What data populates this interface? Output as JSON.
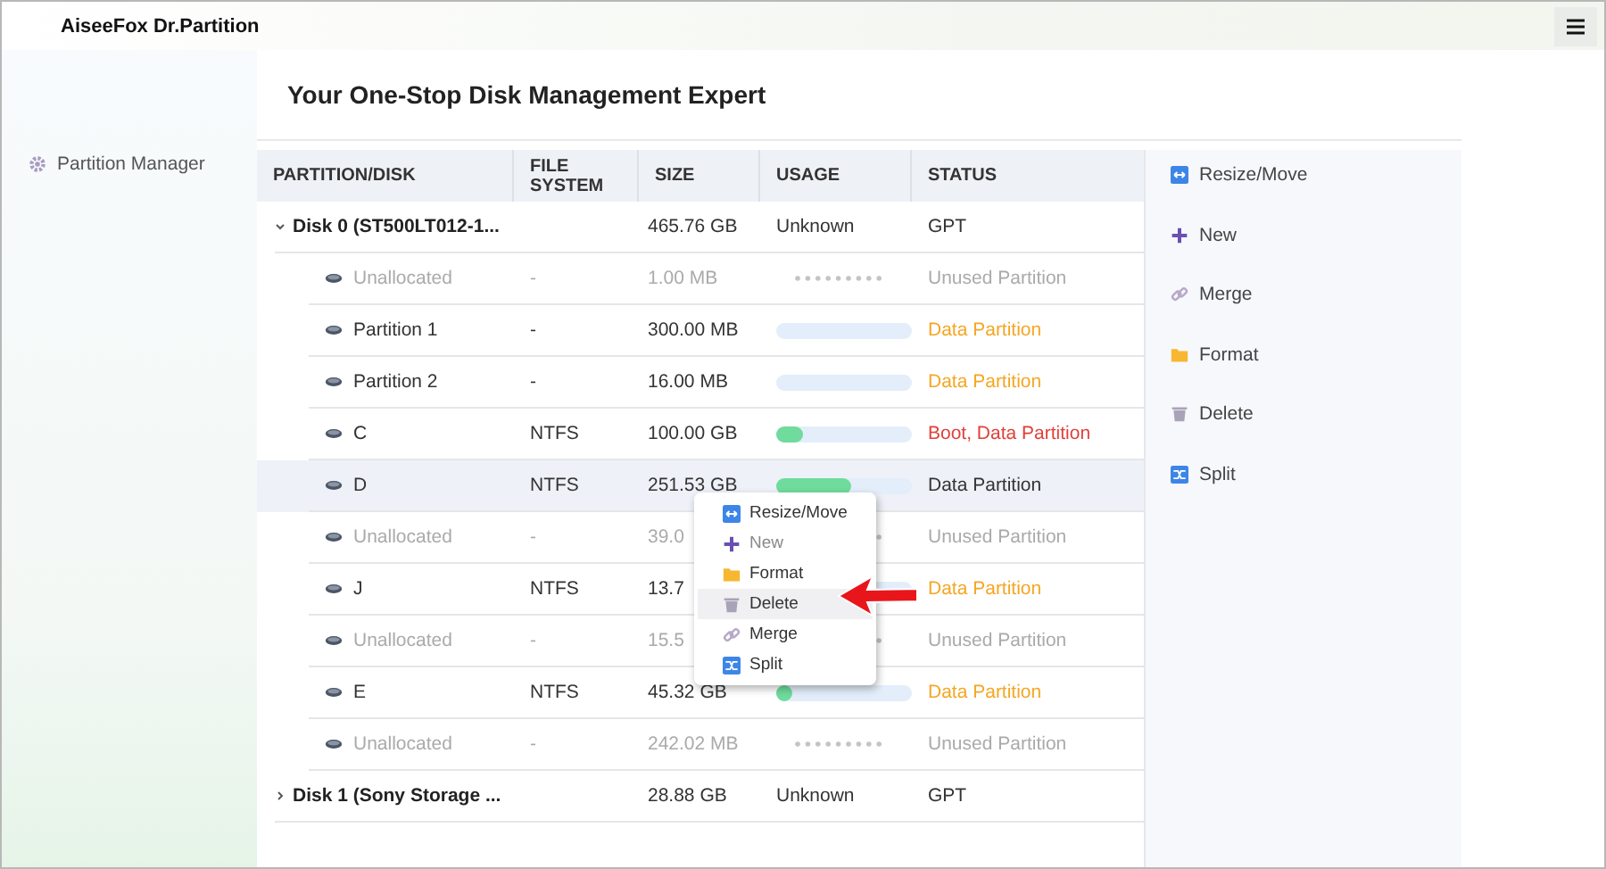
{
  "window": {
    "title": "AiseeFox Dr.Partition"
  },
  "sidebar": {
    "items": [
      {
        "label": "Partition Manager",
        "selected": false
      }
    ]
  },
  "heading": "Your One-Stop Disk Management Expert",
  "table": {
    "columns": [
      "PARTITION/DISK",
      "FILE SYSTEM",
      "SIZE",
      "USAGE",
      "STATUS"
    ],
    "rows": [
      {
        "kind": "disk",
        "name": "Disk 0 (ST500LT012-1...",
        "expanded": true,
        "size": "465.76 GB",
        "usage": {
          "kind": "text",
          "text": "Unknown"
        },
        "status": {
          "text": "GPT",
          "color": "#333333"
        },
        "selected": false
      },
      {
        "kind": "unallocated",
        "name": "Unallocated",
        "file_system": "-",
        "size": "1.00 MB",
        "usage": {
          "kind": "dots"
        },
        "status": {
          "text": "Unused Partition",
          "color": "#aaaaaa"
        },
        "selected": false
      },
      {
        "kind": "partition",
        "name": "Partition 1",
        "file_system": "-",
        "size": "300.00 MB",
        "usage": {
          "kind": "bar"
        },
        "status": {
          "text": "Data Partition",
          "color": "#f5a623"
        },
        "selected": false
      },
      {
        "kind": "partition",
        "name": "Partition 2",
        "file_system": "-",
        "size": "16.00 MB",
        "usage": {
          "kind": "bar"
        },
        "status": {
          "text": "Data Partition",
          "color": "#f5a623"
        },
        "selected": false
      },
      {
        "kind": "partition",
        "name": "C",
        "file_system": "NTFS",
        "size": "100.00 GB",
        "usage": {
          "kind": "bar",
          "level": 0.2
        },
        "status": {
          "text": "Boot, Data Partition",
          "color": "#e0403a"
        },
        "selected": false
      },
      {
        "kind": "partition",
        "name": "D",
        "file_system": "NTFS",
        "size": "251.53 GB",
        "usage": {
          "kind": "bar",
          "level": 0.55
        },
        "status": {
          "text": "Data Partition",
          "color": "#333333"
        },
        "selected": true
      },
      {
        "kind": "unallocated",
        "name": "Unallocated",
        "file_system": "-",
        "size": "39.0",
        "usage": {
          "kind": "dots"
        },
        "status": {
          "text": "Unused Partition",
          "color": "#aaaaaa"
        },
        "selected": false
      },
      {
        "kind": "partition",
        "name": "J",
        "file_system": "NTFS",
        "size": "13.7",
        "usage": {
          "kind": "bar"
        },
        "status": {
          "text": "Data Partition",
          "color": "#f5a623"
        },
        "selected": false
      },
      {
        "kind": "unallocated",
        "name": "Unallocated",
        "file_system": "-",
        "size": "15.5",
        "usage": {
          "kind": "dots"
        },
        "status": {
          "text": "Unused Partition",
          "color": "#aaaaaa"
        },
        "selected": false
      },
      {
        "kind": "partition",
        "name": "E",
        "file_system": "NTFS",
        "size": "45.32 GB",
        "usage": {
          "kind": "bar",
          "level": 0.05
        },
        "status": {
          "text": "Data Partition",
          "color": "#f5a623"
        },
        "selected": false
      },
      {
        "kind": "unallocated",
        "name": "Unallocated",
        "file_system": "-",
        "size": "242.02 MB",
        "usage": {
          "kind": "dots"
        },
        "status": {
          "text": "Unused Partition",
          "color": "#aaaaaa"
        },
        "selected": false
      },
      {
        "kind": "disk",
        "name": "Disk 1 (Sony Storage ...",
        "expanded": false,
        "size": "28.88 GB",
        "usage": {
          "kind": "text",
          "text": "Unknown"
        },
        "status": {
          "text": "GPT",
          "color": "#333333"
        },
        "selected": false
      }
    ]
  },
  "actions": [
    {
      "kind": "resize",
      "label": "Resize/Move"
    },
    {
      "kind": "new",
      "label": "New"
    },
    {
      "kind": "merge",
      "label": "Merge"
    },
    {
      "kind": "format",
      "label": "Format"
    },
    {
      "kind": "delete",
      "label": "Delete"
    },
    {
      "kind": "split",
      "label": "Split"
    }
  ],
  "context_menu": {
    "items": [
      {
        "kind": "resize",
        "label": "Resize/Move",
        "disabled": false,
        "selected": false
      },
      {
        "kind": "new",
        "label": "New",
        "disabled": true,
        "selected": false
      },
      {
        "kind": "format",
        "label": "Format",
        "disabled": false,
        "selected": false
      },
      {
        "kind": "delete",
        "label": "Delete",
        "disabled": false,
        "selected": true
      },
      {
        "kind": "merge",
        "label": "Merge",
        "disabled": false,
        "selected": false
      },
      {
        "kind": "split",
        "label": "Split",
        "disabled": false,
        "selected": false
      }
    ]
  }
}
